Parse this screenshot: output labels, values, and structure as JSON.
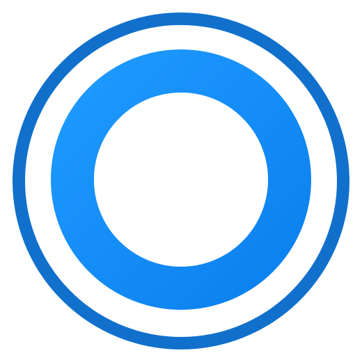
{
  "icon": {
    "name": "ring-logo-icon",
    "colors": {
      "background": "#ffffff",
      "outer_ring": "#1170CC",
      "inner_ring_light": "#1E9AFF",
      "inner_ring_dark": "#0B80EE",
      "center": "#ffffff"
    }
  }
}
